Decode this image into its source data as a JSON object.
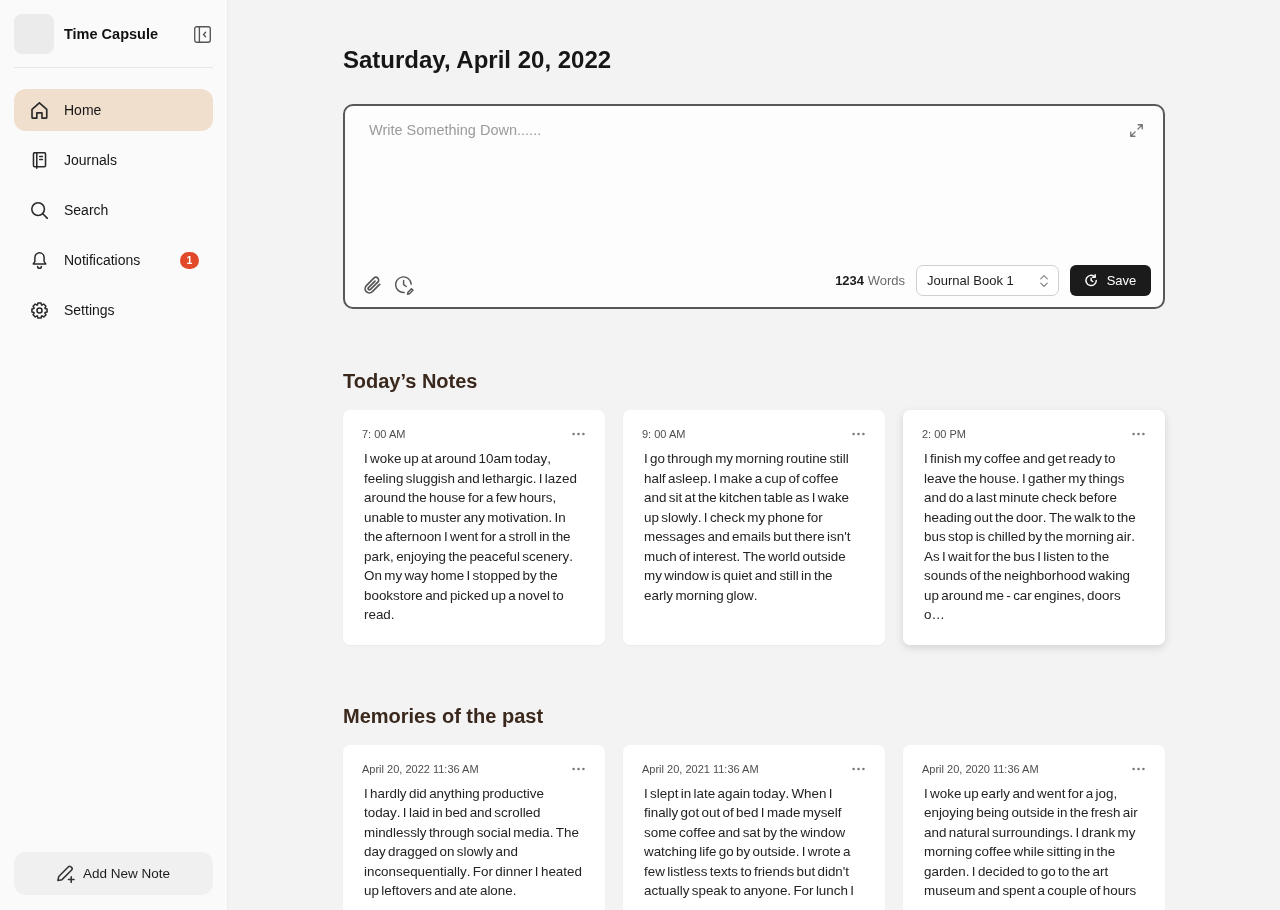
{
  "sidebar": {
    "app_name": "Time Capsule",
    "nav_items": [
      {
        "kind": "home",
        "label": "Home",
        "selected": true
      },
      {
        "kind": "book",
        "label": "Journals",
        "selected": false
      },
      {
        "kind": "search",
        "label": "Search",
        "selected": false
      },
      {
        "kind": "bell",
        "label": "Notifications",
        "selected": false,
        "badge": "1"
      },
      {
        "kind": "gear",
        "label": "Settings",
        "selected": false
      }
    ],
    "add_button": "Add New Note"
  },
  "header": {
    "date": "Saturday, April 20, 2022"
  },
  "editor": {
    "placeholder": "Write Something Down......",
    "word_count": "**1234** Words",
    "journal_select": "Journal Book 1",
    "save_button": "Save"
  },
  "todays_notes": {
    "title": "Today’s Notes",
    "notes": [
      {
        "time": "7: 00 AM",
        "text": "I woke up at around 10am today, feeling sluggish and lethargic. I lazed around the house for a few hours, unable to muster any motivation. In the afternoon I went for a stroll in the park, enjoying the peaceful scenery. On my way home I stopped by the bookstore and picked up a novel to read.",
        "hovered": false
      },
      {
        "time": "9: 00 AM",
        "text": "I go through my morning routine still half asleep. I make a cup of coffee and sit at the kitchen table as I wake up slowly. I check my phone for messages and emails but there isn't much of interest. The world outside my window is quiet and still in the early morning glow.",
        "hovered": false
      },
      {
        "time": "2: 00 PM",
        "text": "I finish my coffee and get ready to leave the house. I gather my things and do a last minute check before heading out the door. The walk to the bus stop is chilled by the morning air. As I wait for the bus I listen to the sounds of the neighborhood waking up around me - car engines, doors o…",
        "hovered": true
      }
    ]
  },
  "memories": {
    "title": "Memories of the past",
    "notes": [
      {
        "time": "April 20, 2022 11:36 AM",
        "text": "I hardly did anything productive today. I laid in bed and scrolled mindlessly through social media. The day dragged on slowly and inconsequentially. For dinner I heated up leftovers and ate alone.",
        "hovered": false
      },
      {
        "time": "April 20, 2021 11:36 AM",
        "text": "I slept in late again today. When I finally got out of bed I made myself some coffee and sat by the window watching life go by outside. I wrote a few listless texts to friends but didn't actually speak to anyone. For lunch I",
        "hovered": false
      },
      {
        "time": "April 20, 2020 11:36 AM",
        "text": "I woke up early and went for a jog, enjoying being outside in the fresh air and natural surroundings. I drank my morning coffee while sitting in the garden. I decided to go to the art museum and spent a couple of hours",
        "hovered": false
      }
    ]
  }
}
